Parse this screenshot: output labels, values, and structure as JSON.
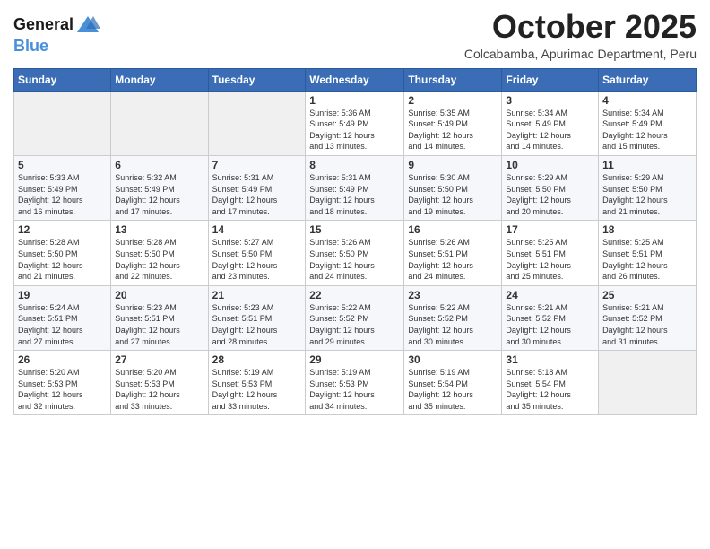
{
  "logo": {
    "line1": "General",
    "line2": "Blue"
  },
  "header": {
    "month": "October 2025",
    "location": "Colcabamba, Apurimac Department, Peru"
  },
  "weekdays": [
    "Sunday",
    "Monday",
    "Tuesday",
    "Wednesday",
    "Thursday",
    "Friday",
    "Saturday"
  ],
  "weeks": [
    [
      {
        "day": "",
        "info": ""
      },
      {
        "day": "",
        "info": ""
      },
      {
        "day": "",
        "info": ""
      },
      {
        "day": "1",
        "info": "Sunrise: 5:36 AM\nSunset: 5:49 PM\nDaylight: 12 hours\nand 13 minutes."
      },
      {
        "day": "2",
        "info": "Sunrise: 5:35 AM\nSunset: 5:49 PM\nDaylight: 12 hours\nand 14 minutes."
      },
      {
        "day": "3",
        "info": "Sunrise: 5:34 AM\nSunset: 5:49 PM\nDaylight: 12 hours\nand 14 minutes."
      },
      {
        "day": "4",
        "info": "Sunrise: 5:34 AM\nSunset: 5:49 PM\nDaylight: 12 hours\nand 15 minutes."
      }
    ],
    [
      {
        "day": "5",
        "info": "Sunrise: 5:33 AM\nSunset: 5:49 PM\nDaylight: 12 hours\nand 16 minutes."
      },
      {
        "day": "6",
        "info": "Sunrise: 5:32 AM\nSunset: 5:49 PM\nDaylight: 12 hours\nand 17 minutes."
      },
      {
        "day": "7",
        "info": "Sunrise: 5:31 AM\nSunset: 5:49 PM\nDaylight: 12 hours\nand 17 minutes."
      },
      {
        "day": "8",
        "info": "Sunrise: 5:31 AM\nSunset: 5:49 PM\nDaylight: 12 hours\nand 18 minutes."
      },
      {
        "day": "9",
        "info": "Sunrise: 5:30 AM\nSunset: 5:50 PM\nDaylight: 12 hours\nand 19 minutes."
      },
      {
        "day": "10",
        "info": "Sunrise: 5:29 AM\nSunset: 5:50 PM\nDaylight: 12 hours\nand 20 minutes."
      },
      {
        "day": "11",
        "info": "Sunrise: 5:29 AM\nSunset: 5:50 PM\nDaylight: 12 hours\nand 21 minutes."
      }
    ],
    [
      {
        "day": "12",
        "info": "Sunrise: 5:28 AM\nSunset: 5:50 PM\nDaylight: 12 hours\nand 21 minutes."
      },
      {
        "day": "13",
        "info": "Sunrise: 5:28 AM\nSunset: 5:50 PM\nDaylight: 12 hours\nand 22 minutes."
      },
      {
        "day": "14",
        "info": "Sunrise: 5:27 AM\nSunset: 5:50 PM\nDaylight: 12 hours\nand 23 minutes."
      },
      {
        "day": "15",
        "info": "Sunrise: 5:26 AM\nSunset: 5:50 PM\nDaylight: 12 hours\nand 24 minutes."
      },
      {
        "day": "16",
        "info": "Sunrise: 5:26 AM\nSunset: 5:51 PM\nDaylight: 12 hours\nand 24 minutes."
      },
      {
        "day": "17",
        "info": "Sunrise: 5:25 AM\nSunset: 5:51 PM\nDaylight: 12 hours\nand 25 minutes."
      },
      {
        "day": "18",
        "info": "Sunrise: 5:25 AM\nSunset: 5:51 PM\nDaylight: 12 hours\nand 26 minutes."
      }
    ],
    [
      {
        "day": "19",
        "info": "Sunrise: 5:24 AM\nSunset: 5:51 PM\nDaylight: 12 hours\nand 27 minutes."
      },
      {
        "day": "20",
        "info": "Sunrise: 5:23 AM\nSunset: 5:51 PM\nDaylight: 12 hours\nand 27 minutes."
      },
      {
        "day": "21",
        "info": "Sunrise: 5:23 AM\nSunset: 5:51 PM\nDaylight: 12 hours\nand 28 minutes."
      },
      {
        "day": "22",
        "info": "Sunrise: 5:22 AM\nSunset: 5:52 PM\nDaylight: 12 hours\nand 29 minutes."
      },
      {
        "day": "23",
        "info": "Sunrise: 5:22 AM\nSunset: 5:52 PM\nDaylight: 12 hours\nand 30 minutes."
      },
      {
        "day": "24",
        "info": "Sunrise: 5:21 AM\nSunset: 5:52 PM\nDaylight: 12 hours\nand 30 minutes."
      },
      {
        "day": "25",
        "info": "Sunrise: 5:21 AM\nSunset: 5:52 PM\nDaylight: 12 hours\nand 31 minutes."
      }
    ],
    [
      {
        "day": "26",
        "info": "Sunrise: 5:20 AM\nSunset: 5:53 PM\nDaylight: 12 hours\nand 32 minutes."
      },
      {
        "day": "27",
        "info": "Sunrise: 5:20 AM\nSunset: 5:53 PM\nDaylight: 12 hours\nand 33 minutes."
      },
      {
        "day": "28",
        "info": "Sunrise: 5:19 AM\nSunset: 5:53 PM\nDaylight: 12 hours\nand 33 minutes."
      },
      {
        "day": "29",
        "info": "Sunrise: 5:19 AM\nSunset: 5:53 PM\nDaylight: 12 hours\nand 34 minutes."
      },
      {
        "day": "30",
        "info": "Sunrise: 5:19 AM\nSunset: 5:54 PM\nDaylight: 12 hours\nand 35 minutes."
      },
      {
        "day": "31",
        "info": "Sunrise: 5:18 AM\nSunset: 5:54 PM\nDaylight: 12 hours\nand 35 minutes."
      },
      {
        "day": "",
        "info": ""
      }
    ]
  ]
}
